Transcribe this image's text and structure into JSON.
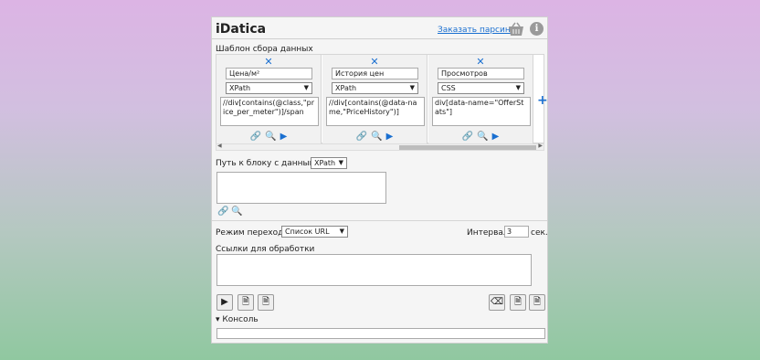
{
  "app": {
    "title": "iDatica",
    "order_link": "Заказать парсинг",
    "info": "i"
  },
  "template": {
    "label": "Шаблон сбора данных",
    "columns": [
      {
        "name": "Цена/м²",
        "method": "XPath",
        "expression": "//div[contains(@class,\"price_per_meter\")]/span"
      },
      {
        "name": "История цен",
        "method": "XPath",
        "expression": "//div[contains(@data-name,\"PriceHistory\")]"
      },
      {
        "name": "Просмотров",
        "method": "CSS",
        "expression": "div[data-name=\"OfferStats\"]"
      }
    ],
    "add": "+"
  },
  "block": {
    "label": "Путь к блоку с данными",
    "method": "XPath",
    "value": ""
  },
  "navigation": {
    "mode_label": "Режим перехода",
    "mode_value": "Список URL",
    "interval_label": "Интервал",
    "interval_value": "3",
    "interval_unit": "сек."
  },
  "links": {
    "label": "Ссылки для обработки",
    "value": ""
  },
  "console": {
    "label": "▾ Консоль"
  },
  "colors": {
    "accent": "#1a6fd0",
    "panel": "#f5f5f5"
  }
}
